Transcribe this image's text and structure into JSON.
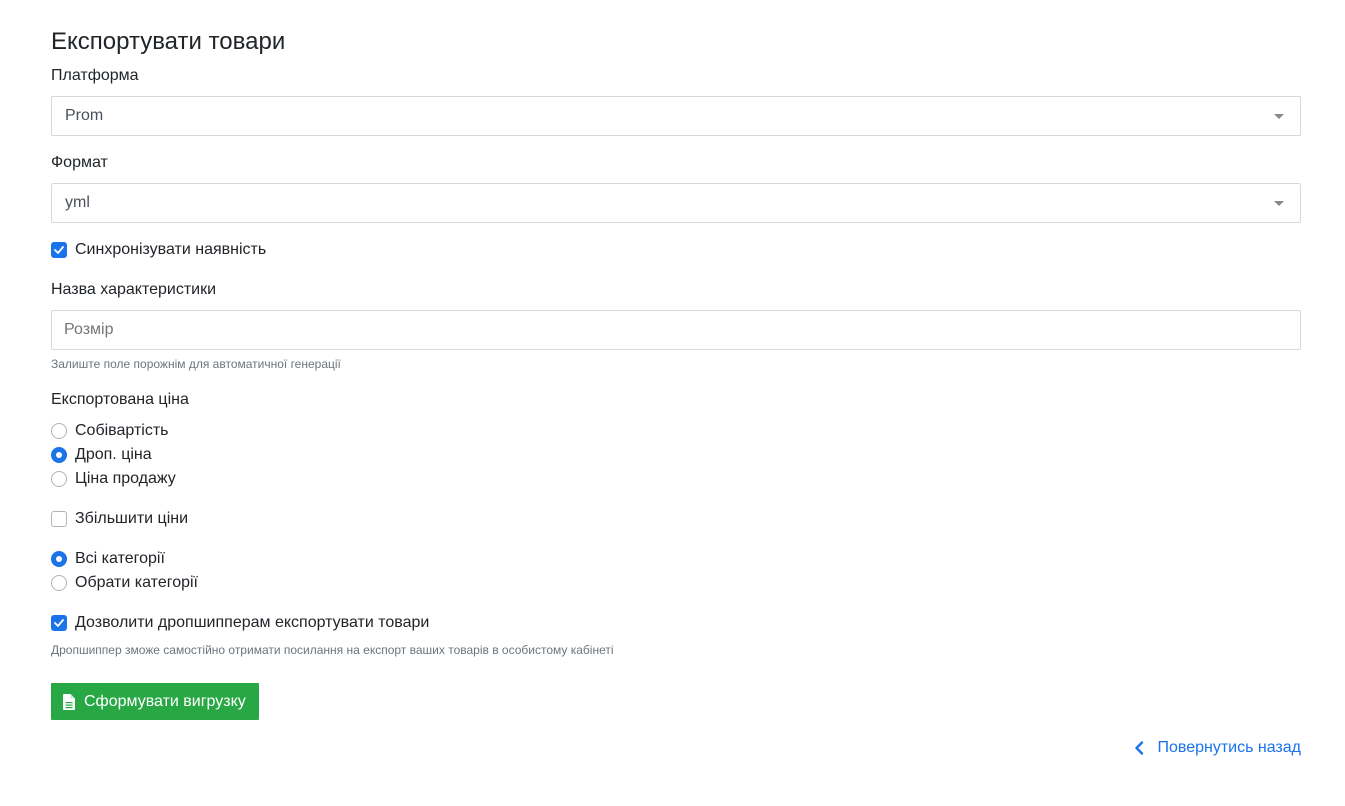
{
  "page": {
    "title": "Експортувати товари"
  },
  "platform": {
    "label": "Платформа",
    "value": "Prom"
  },
  "format": {
    "label": "Формат",
    "value": "yml"
  },
  "sync_stock": {
    "label": "Синхронізувати наявність",
    "checked": true
  },
  "characteristic": {
    "label": "Назва характеристики",
    "placeholder": "Розмір",
    "value": "",
    "help": "Залиште поле порожнім для автоматичної генерації"
  },
  "price": {
    "label": "Експортована ціна",
    "options": [
      {
        "label": "Собівартість",
        "checked": false
      },
      {
        "label": "Дроп. ціна",
        "checked": true
      },
      {
        "label": "Ціна продажу",
        "checked": false
      }
    ]
  },
  "increase_prices": {
    "label": "Збільшити ціни",
    "checked": false
  },
  "categories": {
    "options": [
      {
        "label": "Всі категорії",
        "checked": true
      },
      {
        "label": "Обрати категорії",
        "checked": false
      }
    ]
  },
  "allow_dropshippers": {
    "label": "Дозволити дропшипперам експортувати товари",
    "checked": true,
    "help": "Дропшиппер зможе самостійно отримати посилання на експорт ваших товарів в особистому кабінеті"
  },
  "generate_button": {
    "label": "Сформувати вигрузку",
    "icon": "file-icon",
    "color": "#28a745"
  },
  "back_link": {
    "label": "Повернутись назад",
    "icon": "chevron-left-icon",
    "color": "#1a73e8"
  },
  "colors": {
    "accent": "#1a73e8",
    "success": "#28a745",
    "muted": "#6c757d"
  }
}
